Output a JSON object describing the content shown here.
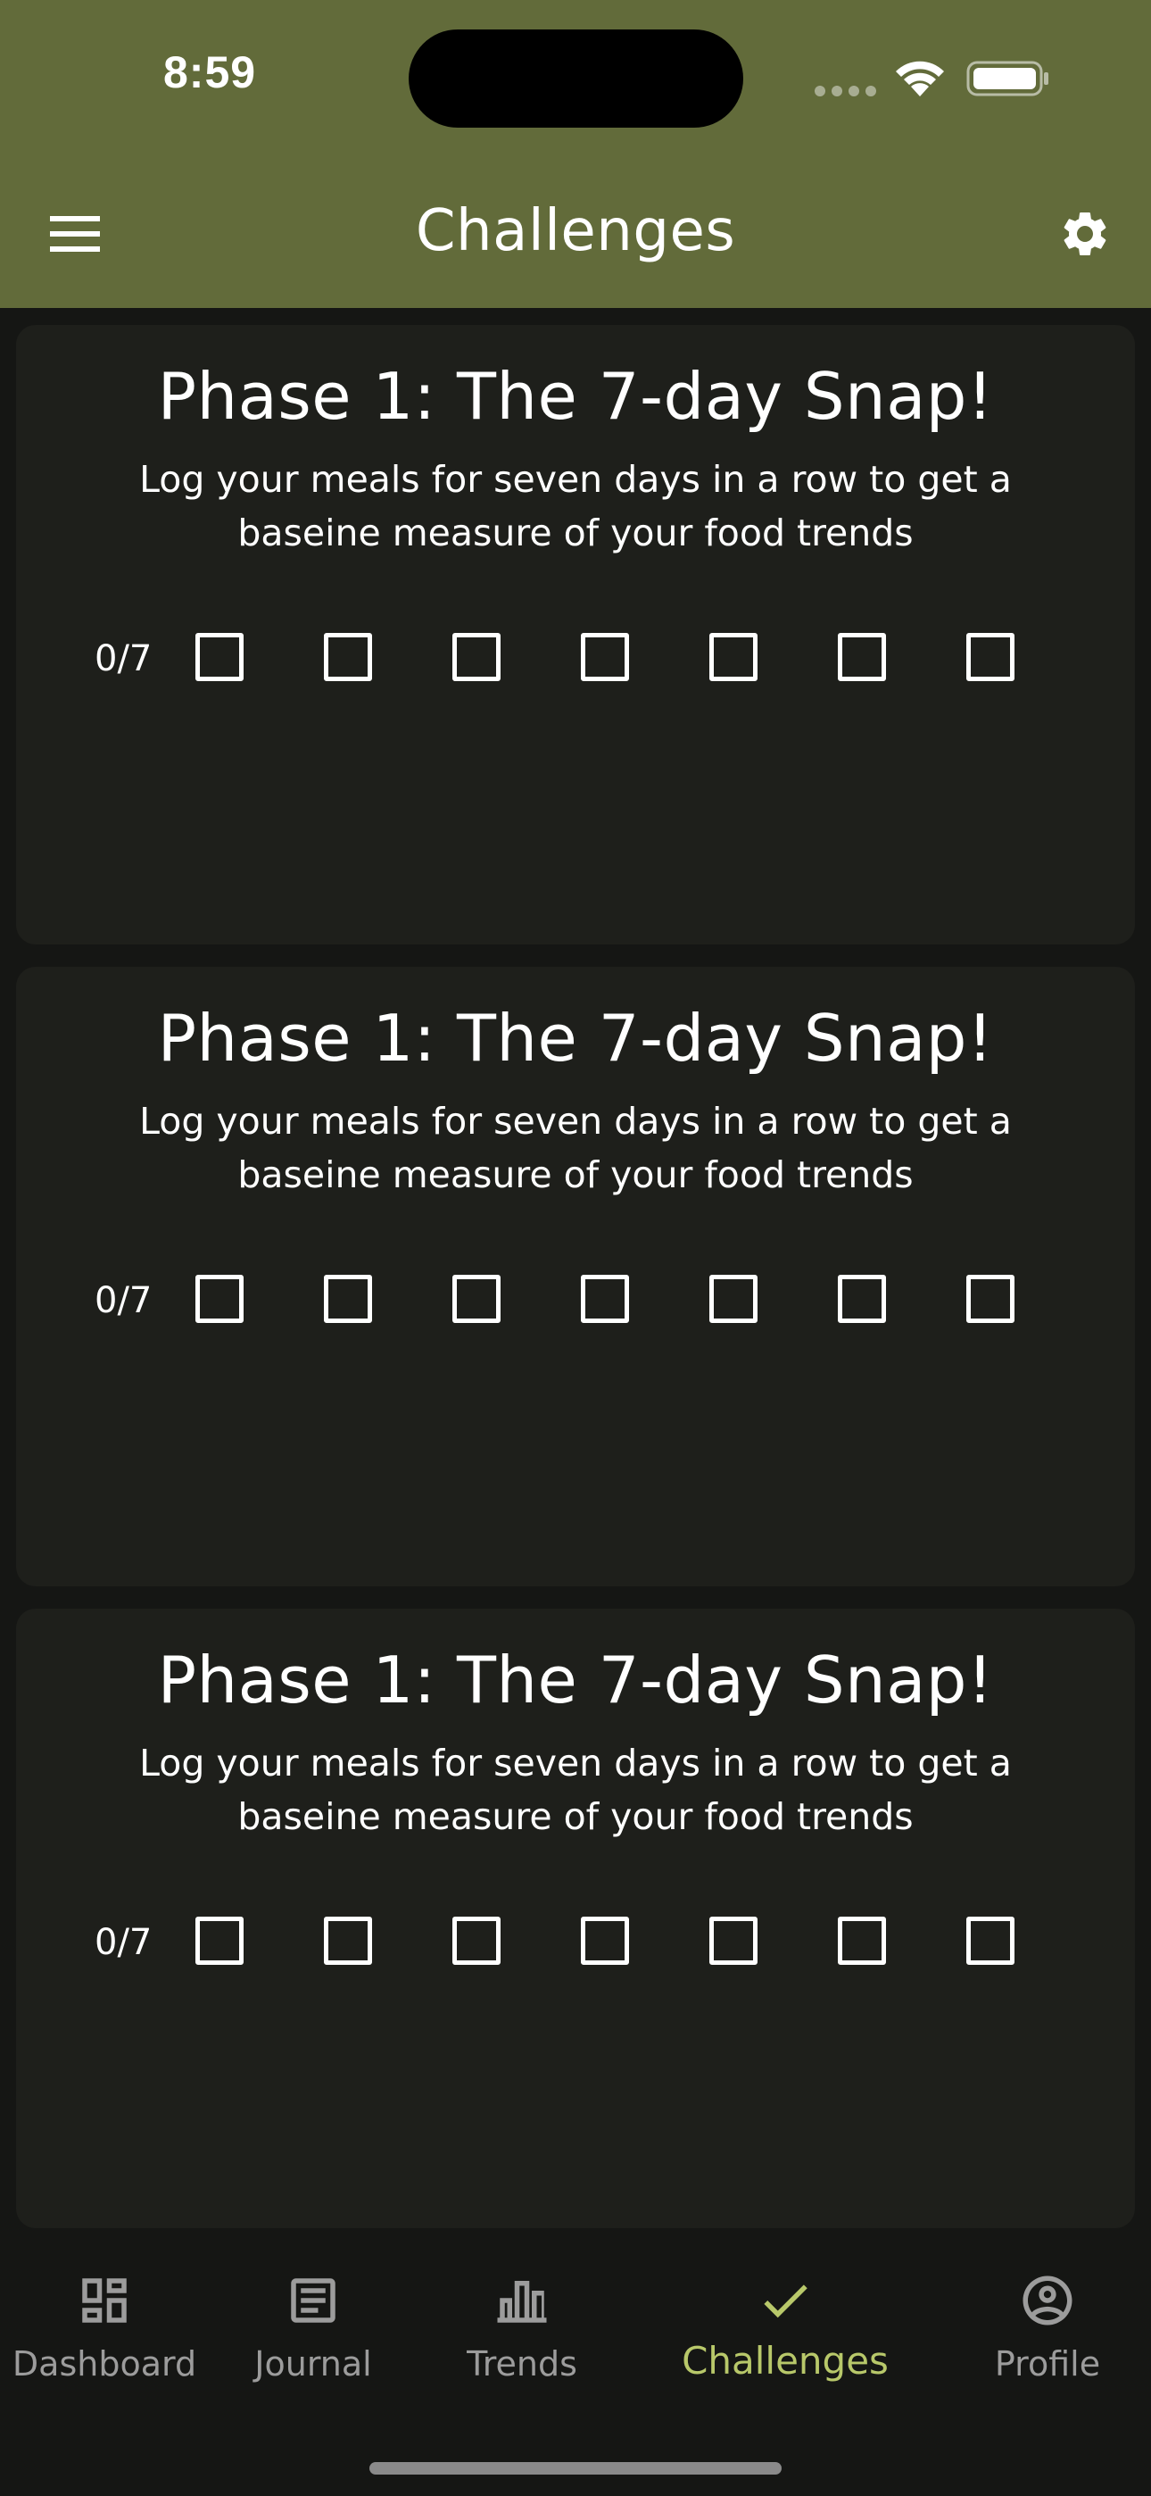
{
  "status_bar": {
    "time": "8:59"
  },
  "header": {
    "title": "Challenges",
    "background_color": "#626b3a",
    "menu_icon": "hamburger-menu-icon",
    "settings_icon": "gear-icon"
  },
  "cards": [
    {
      "title": "Phase 1: The 7-day Snap!",
      "description": "Log your meals for seven days in a row to get a baseine measure of your food trends",
      "progress": "0/7",
      "days_completed": 0,
      "days_total": 7
    },
    {
      "title": "Phase 1: The 7-day Snap!",
      "description": "Log your meals for seven days in a row to get a baseine measure of your food trends",
      "progress": "0/7",
      "days_completed": 0,
      "days_total": 7
    },
    {
      "title": "Phase 1: The 7-day Snap!",
      "description": "Log your meals for seven days in a row to get a baseine measure of your food trends",
      "progress": "0/7",
      "days_completed": 0,
      "days_total": 7
    }
  ],
  "bottom_nav": {
    "items": [
      {
        "label": "Dashboard",
        "icon": "dashboard-icon",
        "active": false
      },
      {
        "label": "Journal",
        "icon": "journal-icon",
        "active": false
      },
      {
        "label": "Trends",
        "icon": "bar-chart-icon",
        "active": false
      },
      {
        "label": "Challenges",
        "icon": "checkmark-icon",
        "active": true
      },
      {
        "label": "Profile",
        "icon": "profile-icon",
        "active": false
      }
    ],
    "active_color": "#b8c86a",
    "inactive_color": "#9c9c9c"
  }
}
